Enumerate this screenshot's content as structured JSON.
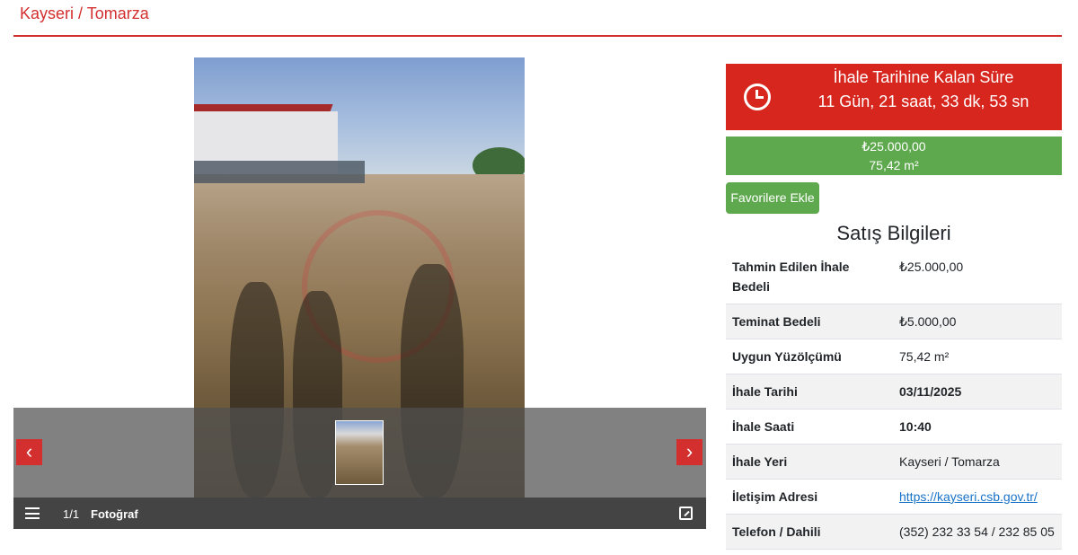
{
  "page": {
    "title": "Kayseri / Tomarza"
  },
  "gallery": {
    "counter": "1/1",
    "caption": "Fotoğraf",
    "prev_label": "‹",
    "next_label": "›"
  },
  "countdown": {
    "title": "İhale Tarihine Kalan Süre",
    "value": "11 Gün, 21 saat, 33 dk, 53 sn"
  },
  "summary": {
    "price": "₺25.000,00",
    "area": "75,42 m²"
  },
  "favorite_button": "Favorilere Ekle",
  "sale_info": {
    "title": "Satış Bilgileri",
    "rows": [
      {
        "label": "Tahmin Edilen İhale Bedeli",
        "value": "₺25.000,00"
      },
      {
        "label": "Teminat Bedeli",
        "value": "₺5.000,00"
      },
      {
        "label": "Uygun Yüzölçümü",
        "value": "75,42 m²"
      },
      {
        "label": "İhale Tarihi",
        "value": "03/11/2025"
      },
      {
        "label": "İhale Saati",
        "value": "10:40"
      },
      {
        "label": "İhale Yeri",
        "value": "Kayseri / Tomarza"
      },
      {
        "label": "İletişim Adresi",
        "value": "https://kayseri.csb.gov.tr/"
      },
      {
        "label": "Telefon / Dahili",
        "value": "(352) 232 33 54 / 232 85 05"
      }
    ]
  },
  "colors": {
    "accent_red": "#d7261e",
    "accent_green": "#5ea94e",
    "link_blue": "#1a73c7"
  },
  "icons": {
    "clock": "clock-icon",
    "list": "list-icon",
    "expand": "expand-icon"
  }
}
